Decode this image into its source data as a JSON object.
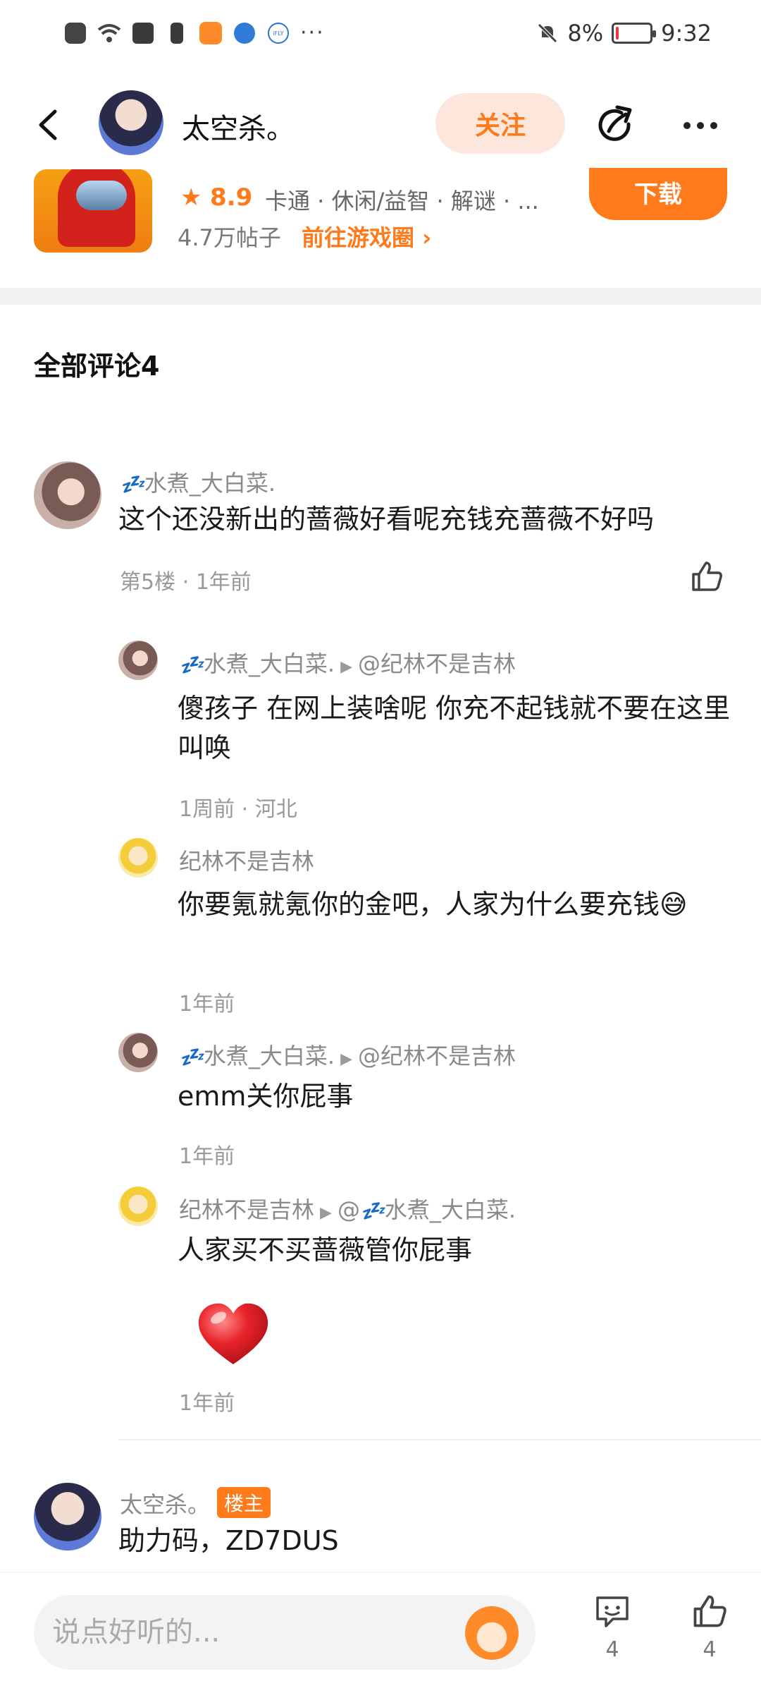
{
  "status_bar": {
    "battery_percent": "8%",
    "time": "9:32",
    "battery_level": 0.08
  },
  "header": {
    "user_name": "太空杀。",
    "follow_label": "关注"
  },
  "game_card": {
    "rating": "8.9",
    "tags": "卡通 · 休闲/益智 · 解谜 · ...",
    "posts": "4.7万帖子",
    "link_label": "前往游戏圈 ›",
    "download_label": "下载"
  },
  "comments_section": {
    "title": "全部评论4"
  },
  "comments": {
    "c1": {
      "zz": "💤",
      "name": "水煮_大白菜.",
      "text": "这个还没新出的蔷薇好看呢充钱充蔷薇不好吗",
      "meta": "第5楼 · 1年前"
    },
    "r1": {
      "zz": "💤",
      "name": "水煮_大白菜.",
      "mention": "@纪林不是吉林",
      "text": "傻孩子 在网上装啥呢 你充不起钱就不要在这里叫唤",
      "meta": "1周前 · 河北"
    },
    "r2": {
      "name": "纪林不是吉林",
      "text": "你要氪就氪你的金吧，人家为什么要充钱😅",
      "meta": "1年前"
    },
    "r3": {
      "zz": "💤",
      "name": "水煮_大白菜.",
      "mention": "@纪林不是吉林",
      "text": "emm关你屁事",
      "meta": "1年前"
    },
    "r4": {
      "name": "纪林不是吉林",
      "mention_prefix": "@",
      "zz": "💤",
      "mention_name": "水煮_大白菜.",
      "text": "人家买不买蔷薇管你屁事",
      "meta": "1年前"
    },
    "c2": {
      "name": "太空杀。",
      "badge": "楼主",
      "text": "助力码，ZD7DUS"
    }
  },
  "bottom_bar": {
    "input_placeholder": "说点好听的...",
    "comment_count": "4",
    "like_count": "4"
  }
}
